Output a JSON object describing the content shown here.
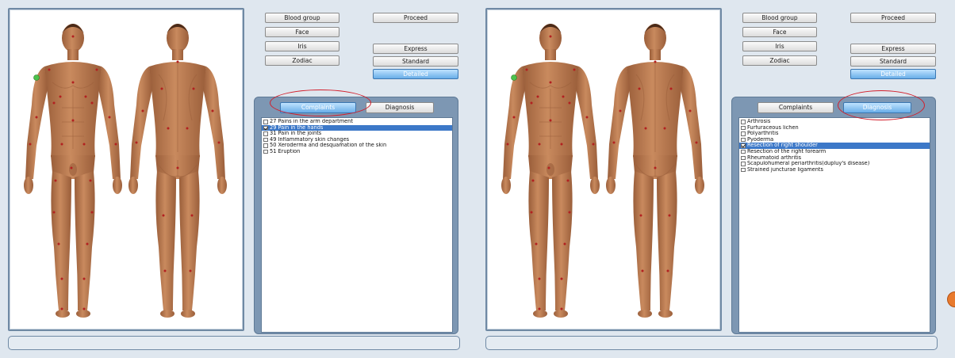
{
  "screens": [
    {
      "controls": {
        "blood_group": "Blood group",
        "face": "Face",
        "iris": "Iris",
        "zodiac": "Zodiac",
        "proceed": "Proceed",
        "express": "Express",
        "standard": "Standard",
        "detailed": "Detailed"
      },
      "selected_mode": "Detailed",
      "tabs": {
        "complaints": "Complaints",
        "diagnosis": "Diagnosis"
      },
      "active_tab": "Complaints",
      "highlighted_tab": "Complaints",
      "items": [
        {
          "label": "27 Pains in the arm department",
          "checked": false,
          "selected": false
        },
        {
          "label": "29 Pain in the hands",
          "checked": true,
          "selected": true
        },
        {
          "label": "31 Pain in the joints",
          "checked": false,
          "selected": false
        },
        {
          "label": "49 Inflammatory skin changes",
          "checked": false,
          "selected": false
        },
        {
          "label": "50 Xeroderma and desquamation of the skin",
          "checked": false,
          "selected": false
        },
        {
          "label": "51 Eruption",
          "checked": false,
          "selected": false
        }
      ],
      "status_text": ""
    },
    {
      "controls": {
        "blood_group": "Blood group",
        "face": "Face",
        "iris": "Iris",
        "zodiac": "Zodiac",
        "proceed": "Proceed",
        "express": "Express",
        "standard": "Standard",
        "detailed": "Detailed"
      },
      "selected_mode": "Detailed",
      "tabs": {
        "complaints": "Complaints",
        "diagnosis": "Diagnosis"
      },
      "active_tab": "Diagnosis",
      "highlighted_tab": "Diagnosis",
      "items": [
        {
          "label": "Arthrosis",
          "checked": false,
          "selected": false
        },
        {
          "label": "Furfuraceous lichen",
          "checked": false,
          "selected": false
        },
        {
          "label": "Polyarthritis",
          "checked": false,
          "selected": false
        },
        {
          "label": "Pyoderma",
          "checked": false,
          "selected": false
        },
        {
          "label": "Resection of right shoulder",
          "checked": true,
          "selected": true
        },
        {
          "label": "Resection of the right forearm",
          "checked": false,
          "selected": false
        },
        {
          "label": "Rheumatoid arthritis",
          "checked": false,
          "selected": false
        },
        {
          "label": "Scapulohumeral periarthritis(dupluy's disease)",
          "checked": false,
          "selected": false
        },
        {
          "label": "Strained juncturae ligaments",
          "checked": false,
          "selected": false
        }
      ],
      "status_text": ""
    }
  ],
  "colors": {
    "skin": "#c98a5e",
    "skin_shadow": "#9a5e3a",
    "point": "#b32020",
    "active_point": "#4cc24c",
    "highlight": "#d21e2b",
    "selection": "#3c78c8"
  }
}
